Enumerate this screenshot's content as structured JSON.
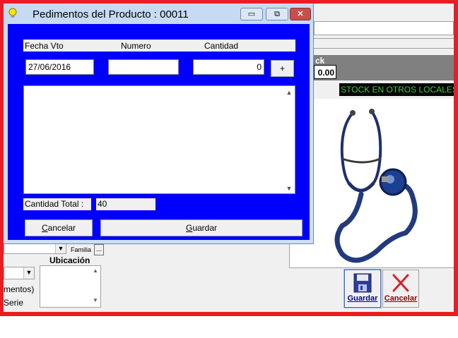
{
  "dialog": {
    "title": "Pedimentos del Producto : 00011",
    "controls": {
      "minimize": "▭",
      "maximize": "⧉",
      "close": "✕"
    },
    "headers": {
      "fecha": "Fecha  Vto",
      "numero": "Numero",
      "cantidad": "Cantidad"
    },
    "inputs": {
      "fecha_value": "27/06/2016",
      "numero_value": "",
      "cantidad_value": "0"
    },
    "plus_label": "+",
    "total": {
      "label": "Cantidad Total  :",
      "value": "40"
    },
    "buttons": {
      "cancelar": {
        "accel": "C",
        "rest": "ancelar"
      },
      "guardar": {
        "accel": "G",
        "rest": "uardar"
      }
    }
  },
  "background": {
    "stock_label": "ck",
    "stock_value": "0.00",
    "stock_otros": "STOCK EN OTROS LOCALES",
    "familia_label": "Familia",
    "ellipsis": "...",
    "ubicacion_label": "Ubicación",
    "mentos_text": "mentos)",
    "serie_text": "Serie",
    "save_button": "Guardar",
    "cancel_button": "Cancelar"
  },
  "colors": {
    "dialog_client": "#0000ff",
    "stock_text": "#3ad23a",
    "outer_frame": "#ec1c24"
  },
  "icons": [
    "lightbulb-icon",
    "floppy-disk-icon",
    "red-x-icon",
    "stethoscope-image"
  ]
}
